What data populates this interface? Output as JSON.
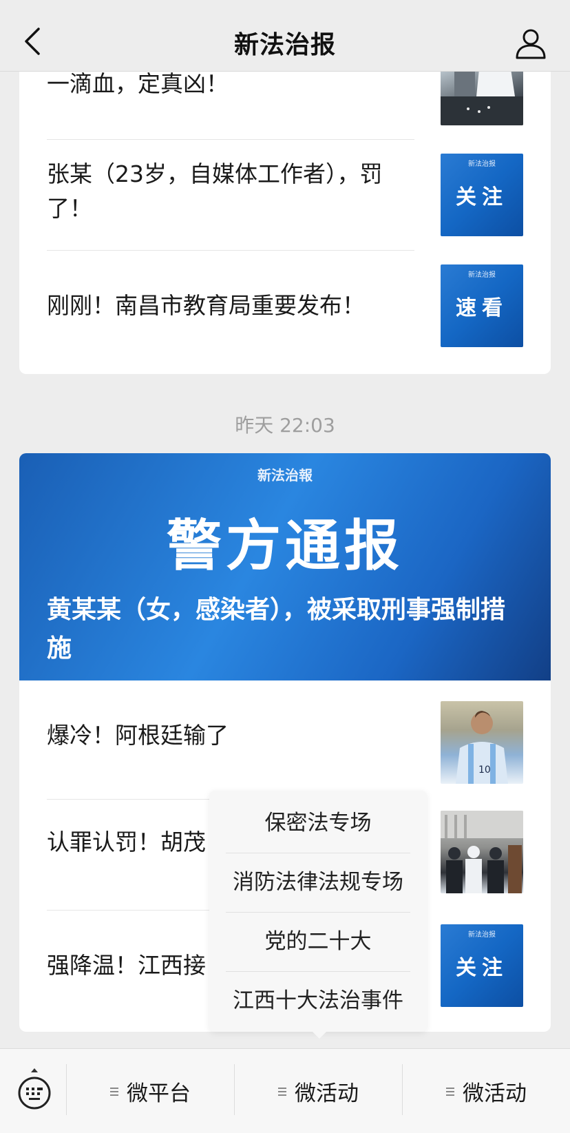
{
  "header": {
    "title": "新法治报",
    "back_icon": "chevron-left-icon",
    "profile_icon": "person-icon"
  },
  "card1": {
    "items": [
      {
        "title": "一滴血，定真凶！",
        "thumb": "lab-photo"
      },
      {
        "title": "张某（23岁，自媒体工作者），罚了！",
        "thumb_mast": "新法治报",
        "thumb_word": "关注"
      },
      {
        "title": "刚刚！南昌市教育局重要发布！",
        "thumb_mast": "新法治报",
        "thumb_word": "速看"
      }
    ]
  },
  "timestamp": "昨天 22:03",
  "card2": {
    "banner": {
      "mast": "新法治報",
      "big": "警方通报",
      "headline": "黄某某（女，感染者），被采取刑事强制措施"
    },
    "items": [
      {
        "title": "爆冷！阿根廷输了",
        "thumb": "football-player-photo"
      },
      {
        "title": "认罪认罚！胡茂",
        "thumb": "courtroom-photo"
      },
      {
        "title": "强降温！江西接",
        "thumb_mast": "新法治报",
        "thumb_word": "关注"
      }
    ]
  },
  "popup": {
    "items": [
      "保密法专场",
      "消防法律法规专场",
      "党的二十大",
      "江西十大法治事件"
    ]
  },
  "bottombar": {
    "keyboard_icon": "keyboard-icon",
    "tabs": [
      "微平台",
      "微活动",
      "微活动"
    ]
  },
  "colors": {
    "accent_blue": "#1b6ec9",
    "background": "#ededed"
  }
}
